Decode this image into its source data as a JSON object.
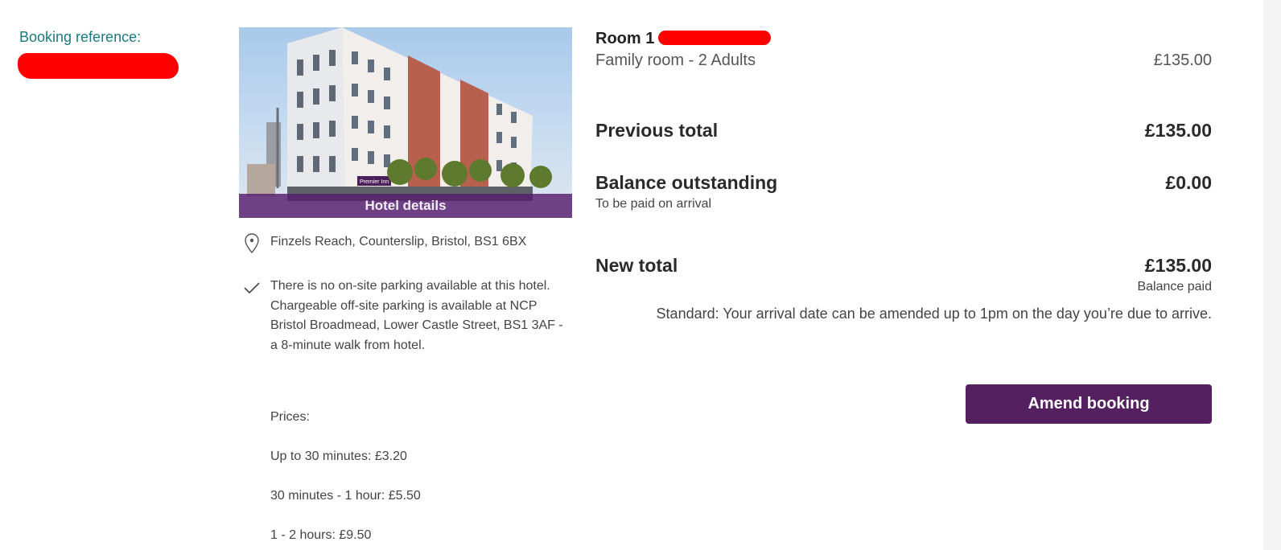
{
  "booking": {
    "reference_label": "Booking reference:"
  },
  "hotel": {
    "details_label": "Hotel details",
    "address": "Finzels Reach, Counterslip, Bristol, BS1 6BX",
    "parking": "There is no on-site parking available at this hotel. Chargeable off-site parking is available at NCP Bristol Broadmead, Lower Castle Street, BS1 3AF - a 8-minute walk from hotel.",
    "prices_heading": "Prices:",
    "prices": [
      "Up to 30 minutes: £3.20",
      "30 minutes - 1 hour: £5.50",
      "1 - 2 hours: £9.50"
    ],
    "sign_text": "Premier Inn"
  },
  "summary": {
    "room_title": "Room 1",
    "room_description": "Family room - 2 Adults",
    "room_price": "£135.00",
    "previous_total_label": "Previous total",
    "previous_total_value": "£135.00",
    "balance_label": "Balance outstanding",
    "balance_value": "£0.00",
    "balance_note": "To be paid on arrival",
    "new_total_label": "New total",
    "new_total_value": "£135.00",
    "new_total_note": "Balance paid",
    "policy_text": "Standard: Your arrival date can be amended up to 1pm on the day you’re due to arrive.",
    "amend_button_label": "Amend booking"
  },
  "colors": {
    "brand_purple": "#55205f",
    "reference_teal": "#1a7a80",
    "redaction_red": "#ff0000"
  },
  "icons": {
    "address": "map-pin-icon",
    "parking": "checkmark-icon"
  }
}
